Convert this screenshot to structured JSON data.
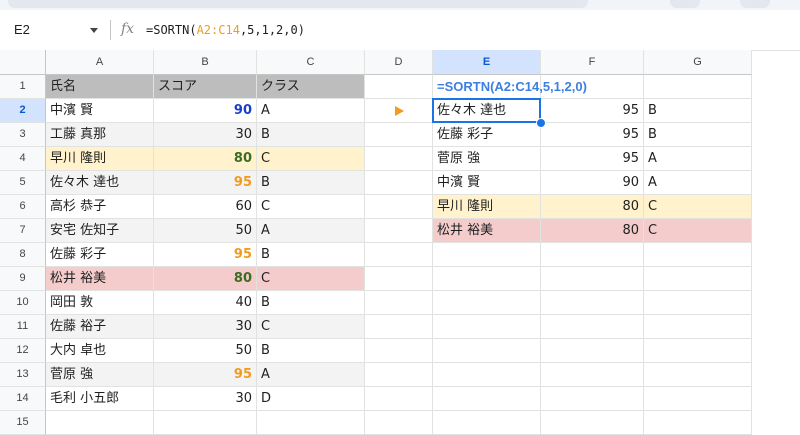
{
  "name_box": "E2",
  "formula_bar": {
    "fx_label": "fx",
    "prefix": "=SORTN(",
    "range": "A2:C14",
    "suffix": ",5,1,2,0)"
  },
  "columns": [
    "A",
    "B",
    "C",
    "D",
    "E",
    "F",
    "G"
  ],
  "rows": [
    "1",
    "2",
    "3",
    "4",
    "5",
    "6",
    "7",
    "8",
    "9",
    "10",
    "11",
    "12",
    "13",
    "14",
    "15"
  ],
  "selected_cell": {
    "column": "E",
    "row": "2"
  },
  "source_table": {
    "headers": [
      "氏名",
      "スコア",
      "クラス"
    ],
    "rows": [
      {
        "name": "中濱 賢",
        "score": "90",
        "class": "A",
        "style": "plain",
        "score_color": "blue"
      },
      {
        "name": "工藤 真那",
        "score": "30",
        "class": "B",
        "style": "band",
        "score_color": ""
      },
      {
        "name": "早川 隆則",
        "score": "80",
        "class": "C",
        "style": "hl-yellow",
        "score_color": "green"
      },
      {
        "name": "佐々木 達也",
        "score": "95",
        "class": "B",
        "style": "band",
        "score_color": "orange"
      },
      {
        "name": "高杉 恭子",
        "score": "60",
        "class": "C",
        "style": "plain",
        "score_color": ""
      },
      {
        "name": "安宅 佐知子",
        "score": "50",
        "class": "A",
        "style": "band",
        "score_color": ""
      },
      {
        "name": "佐藤 彩子",
        "score": "95",
        "class": "B",
        "style": "plain",
        "score_color": "orange"
      },
      {
        "name": "松井 裕美",
        "score": "80",
        "class": "C",
        "style": "hl-red",
        "score_color": "green"
      },
      {
        "name": "岡田 敦",
        "score": "40",
        "class": "B",
        "style": "plain",
        "score_color": ""
      },
      {
        "name": "佐藤 裕子",
        "score": "30",
        "class": "C",
        "style": "band",
        "score_color": ""
      },
      {
        "name": "大内 卓也",
        "score": "50",
        "class": "B",
        "style": "plain",
        "score_color": ""
      },
      {
        "name": "菅原 強",
        "score": "95",
        "class": "A",
        "style": "band",
        "score_color": "orange"
      },
      {
        "name": "毛利 小五郎",
        "score": "30",
        "class": "D",
        "style": "plain",
        "score_color": ""
      }
    ]
  },
  "result_formula_label": "=SORTN(A2:C14,5,1,2,0)",
  "result_table": [
    {
      "name": "佐々木 達也",
      "score": "95",
      "class": "B",
      "style": "plain"
    },
    {
      "name": "佐藤 彩子",
      "score": "95",
      "class": "B",
      "style": "plain"
    },
    {
      "name": "菅原 強",
      "score": "95",
      "class": "A",
      "style": "plain"
    },
    {
      "name": "中濱 賢",
      "score": "90",
      "class": "A",
      "style": "plain"
    },
    {
      "name": "早川 隆則",
      "score": "80",
      "class": "C",
      "style": "hl-yellow"
    },
    {
      "name": "松井 裕美",
      "score": "80",
      "class": "C",
      "style": "hl-red"
    }
  ],
  "colors": {
    "accent_blue": "#1a73e8",
    "arrow_orange": "#f29b1d",
    "highlight_yellow": "#fff2cc",
    "highlight_red": "#f4cccc",
    "header_gray": "#bdbdbd"
  }
}
